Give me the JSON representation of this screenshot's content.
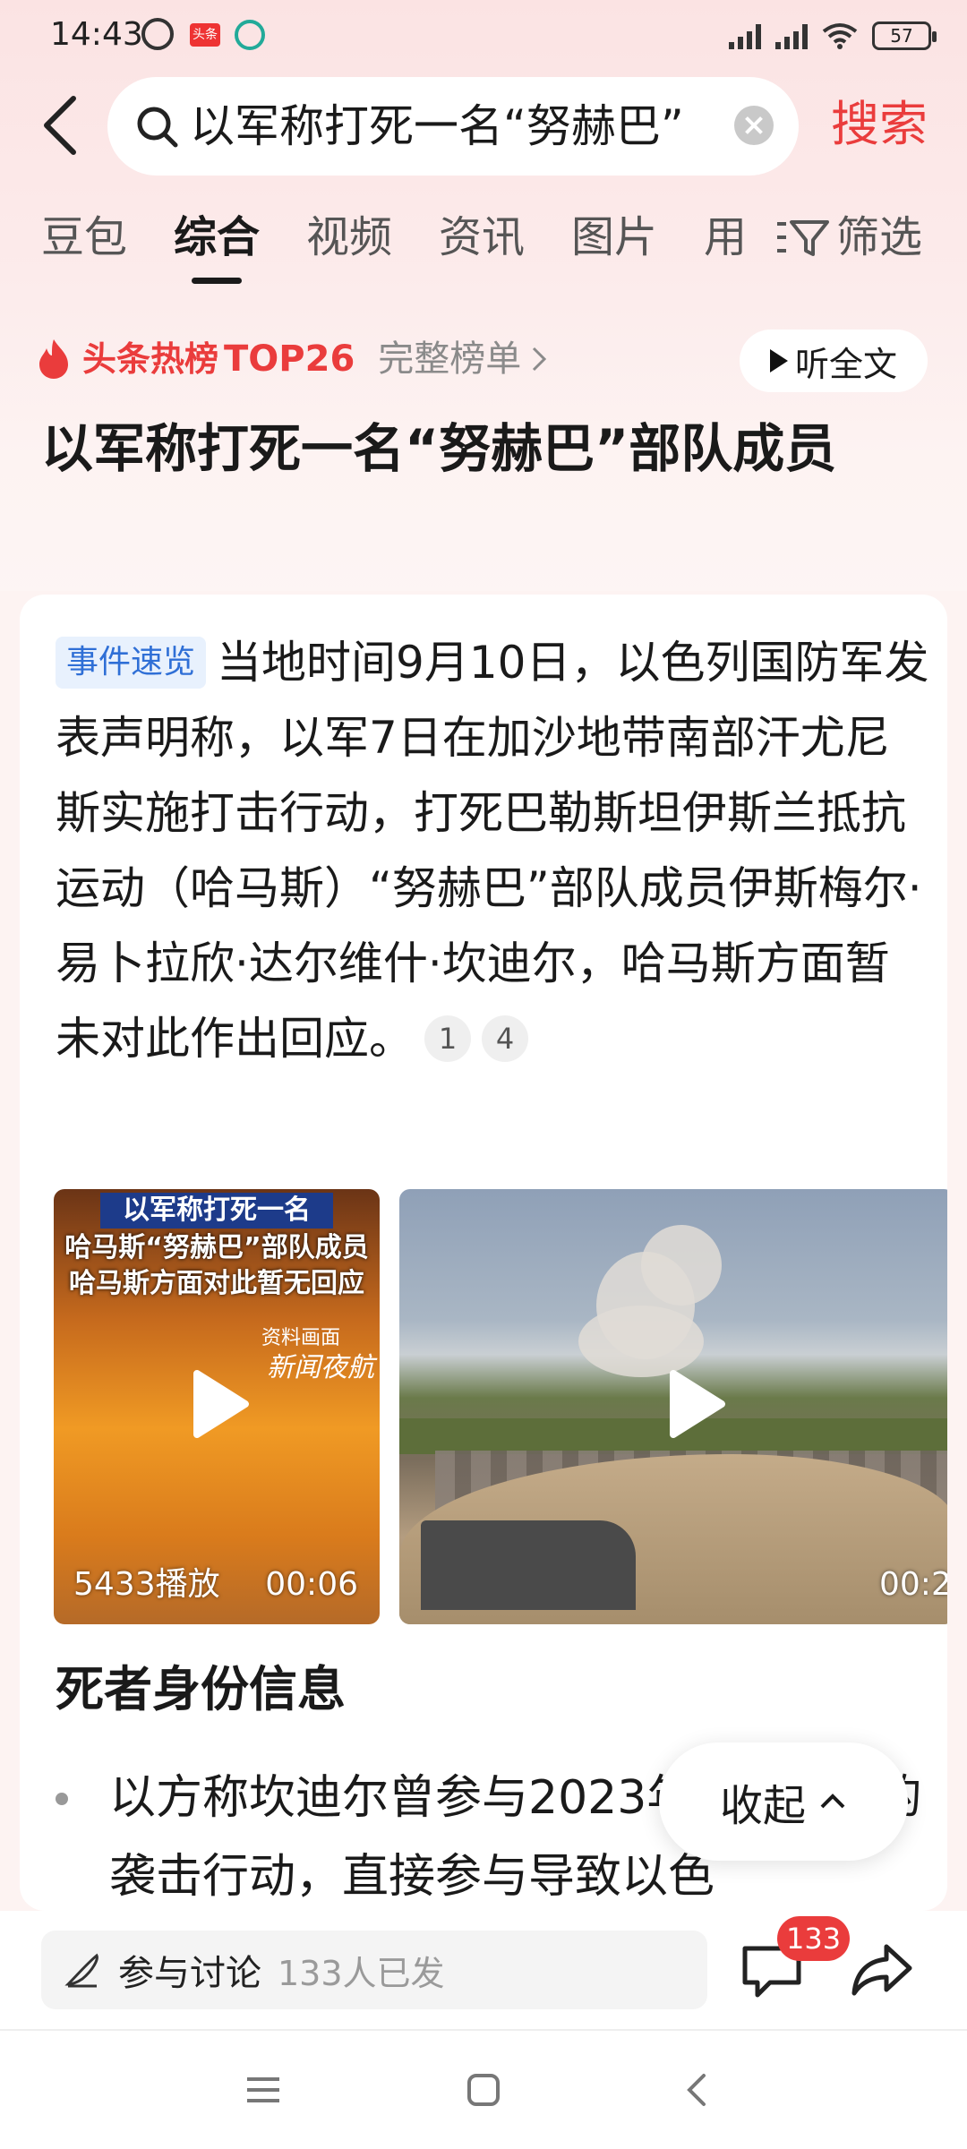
{
  "status_bar": {
    "time": "14:43",
    "app_badge": "头条",
    "battery": "57"
  },
  "search": {
    "query": "以军称打死一名“努赫巴”",
    "submit_label": "搜索"
  },
  "tabs": [
    {
      "label": "豆包",
      "active": false
    },
    {
      "label": "综合",
      "active": true
    },
    {
      "label": "视频",
      "active": false
    },
    {
      "label": "资讯",
      "active": false
    },
    {
      "label": "图片",
      "active": false
    },
    {
      "label": "用",
      "active": false
    }
  ],
  "filter_label": "筛选",
  "hot": {
    "label": "头条热榜",
    "rank": "TOP26",
    "full_list": "完整榜单",
    "listen_label": "听全文"
  },
  "headline": "以军称打死一名“努赫巴”部队成员",
  "summary": {
    "badge": "事件速览",
    "text": "当地时间9月10日，以色列国防军发表声明称，以军7日在加沙地带南部汗尤尼斯实施打击行动，打死巴勒斯坦伊斯兰抵抗运动（哈马斯）“努赫巴”部队成员伊斯梅尔·易卜拉欣·达尔维什·坎迪尔，哈马斯方面暂未对此作出回应。",
    "citations": [
      "1",
      "4"
    ]
  },
  "videos": [
    {
      "caption_line1": "以军称打死一名",
      "caption_line2": "哈马斯“努赫巴”部队成员",
      "caption_line3": "哈马斯方面对此暂无回应",
      "source_note": "资料画面",
      "logo": "新闻夜航",
      "views": "5433播放",
      "duration": "00:06"
    },
    {
      "duration": "00:2"
    }
  ],
  "section_title": "死者身份信息",
  "bullet_text": "以方称坎迪尔曾参与2023年10月7日的袭击行动，直接参与导致以色",
  "collapse_label": "收起",
  "bottom": {
    "discuss_label": "参与讨论",
    "discuss_count": "133人已发",
    "comment_count": "133"
  },
  "colors": {
    "accent": "#ea3c3c",
    "badge_blue": "#2f6fd6",
    "header_bg": "#fbe3e3"
  }
}
